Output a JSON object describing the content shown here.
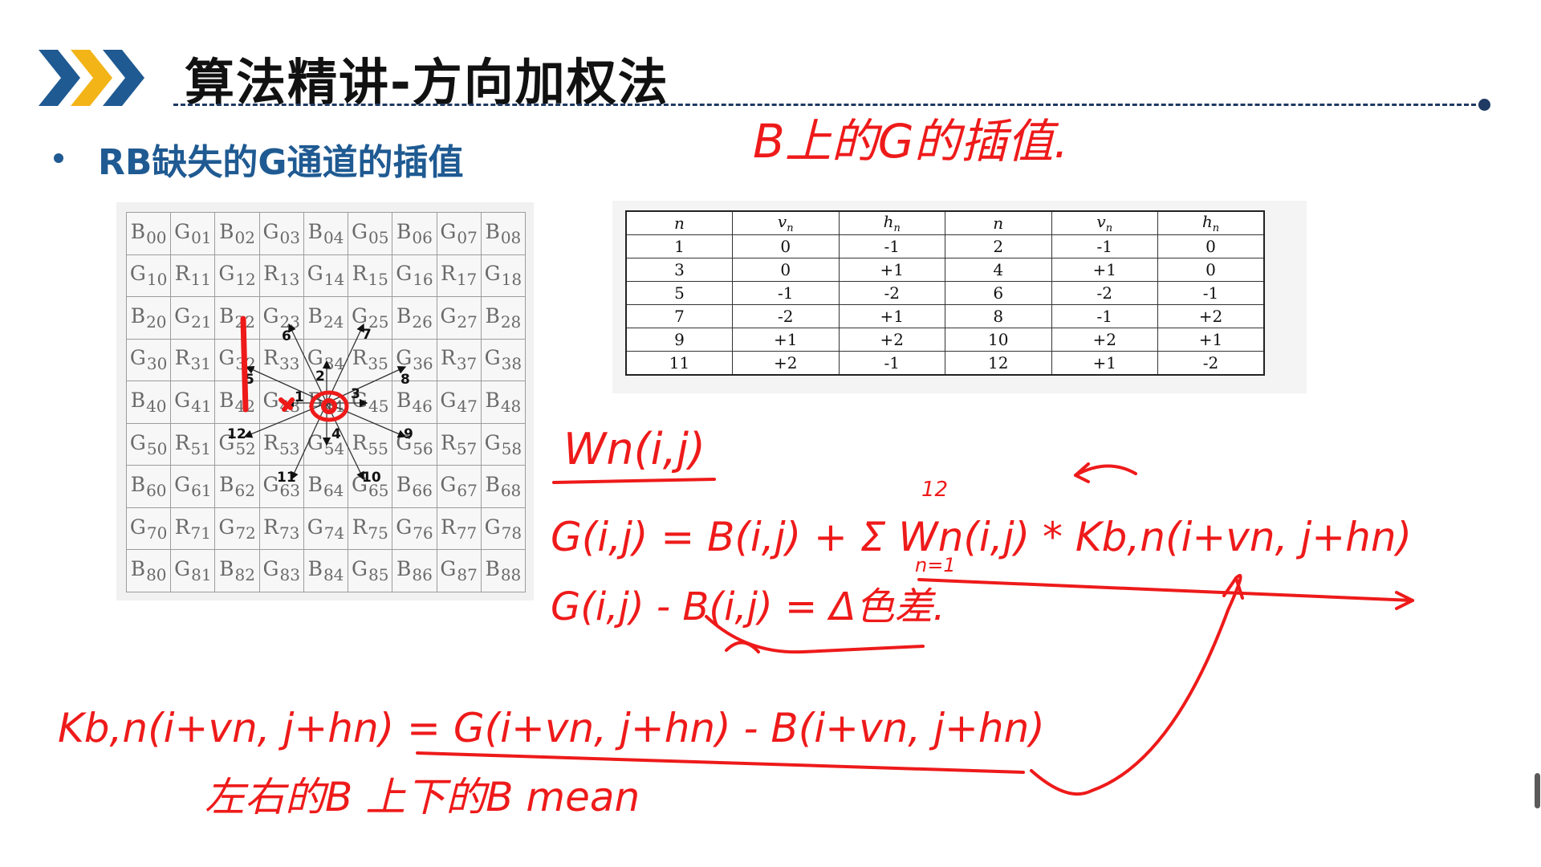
{
  "header": {
    "title": "算法精讲-方向加权法",
    "chevron_colors": [
      "#1f5a92",
      "#f2b417",
      "#1f5a92"
    ],
    "rule_color": "#1f3a63"
  },
  "bullet": {
    "text": "RB缺失的G通道的插值",
    "color": "#1f5a92"
  },
  "bayer_grid": {
    "rows": [
      [
        "B00",
        "G01",
        "B02",
        "G03",
        "B04",
        "G05",
        "B06",
        "G07",
        "B08"
      ],
      [
        "G10",
        "R11",
        "G12",
        "R13",
        "G14",
        "R15",
        "G16",
        "R17",
        "G18"
      ],
      [
        "B20",
        "G21",
        "B22",
        "G23",
        "B24",
        "G25",
        "B26",
        "G27",
        "B28"
      ],
      [
        "G30",
        "R31",
        "G32",
        "R33",
        "G34",
        "R35",
        "G36",
        "R37",
        "G38"
      ],
      [
        "B40",
        "G41",
        "B42",
        "G43",
        "B44",
        "G45",
        "B46",
        "G47",
        "B48"
      ],
      [
        "G50",
        "R51",
        "G52",
        "R53",
        "G54",
        "R55",
        "G56",
        "R57",
        "G58"
      ],
      [
        "B60",
        "G61",
        "B62",
        "G63",
        "B64",
        "G65",
        "B66",
        "G67",
        "B68"
      ],
      [
        "G70",
        "R71",
        "G72",
        "R73",
        "G74",
        "R75",
        "G76",
        "R77",
        "G78"
      ],
      [
        "B80",
        "G81",
        "B82",
        "G83",
        "B84",
        "G85",
        "B86",
        "G87",
        "B88"
      ]
    ],
    "direction_labels": [
      "1",
      "2",
      "3",
      "4",
      "5",
      "6",
      "7",
      "8",
      "9",
      "10",
      "11",
      "12"
    ]
  },
  "offset_table": {
    "headers": [
      "n",
      "vn",
      "hn",
      "n",
      "vn",
      "hn"
    ],
    "rows": [
      [
        "1",
        "0",
        "-1",
        "2",
        "-1",
        "0"
      ],
      [
        "3",
        "0",
        "+1",
        "4",
        "+1",
        "0"
      ],
      [
        "5",
        "-1",
        "-2",
        "6",
        "-2",
        "-1"
      ],
      [
        "7",
        "-2",
        "+1",
        "8",
        "-1",
        "+2"
      ],
      [
        "9",
        "+1",
        "+2",
        "10",
        "+2",
        "+1"
      ],
      [
        "11",
        "+2",
        "-1",
        "12",
        "+1",
        "-2"
      ]
    ]
  },
  "annotations": {
    "ink_color": "#ee1a1a",
    "b_heading": "B上的G的插值.",
    "wn_label": "Wn(i,j)",
    "formula_g": "G(i,j) = B(i,j) + Σ Wn(i,j) * Kb,n(i+vn, j+hn)",
    "sum_upper": "12",
    "sum_lower": "n=1",
    "delta_line": "G(i,j) - B(i,j) = Δ色差.",
    "k_formula": "Kb,n(i+vn, j+hn) = G(i+vn, j+hn) - B(i+vn, j+hn)",
    "note": "左右的B  上下的B  mean"
  }
}
